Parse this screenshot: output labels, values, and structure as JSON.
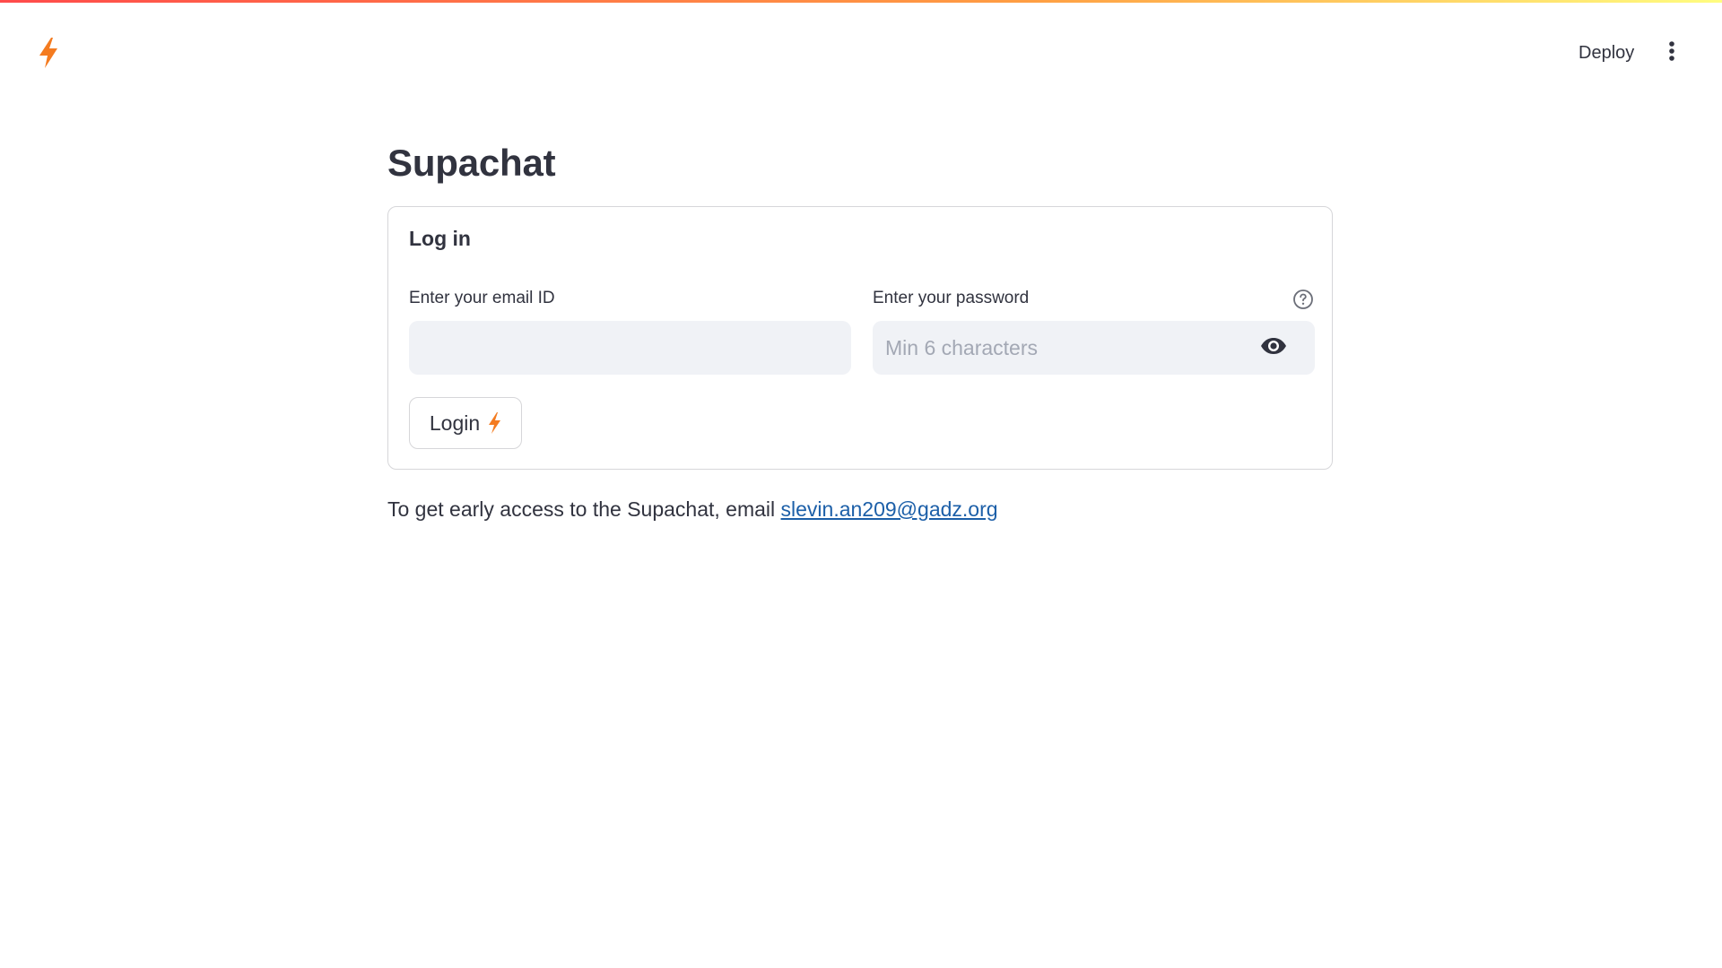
{
  "header": {
    "logo_icon": "lightning-bolt-icon",
    "deploy_label": "Deploy",
    "menu_icon": "vertical-ellipsis-icon"
  },
  "page": {
    "title": "Supachat"
  },
  "login_form": {
    "title": "Log in",
    "email_label": "Enter your email ID",
    "email_value": "",
    "email_placeholder": "",
    "password_label": "Enter your password",
    "password_value": "",
    "password_placeholder": "Min 6 characters",
    "help_icon": "question-circle-icon",
    "show_password_icon": "eye-icon",
    "login_button_label": "Login",
    "login_button_icon": "lightning-bolt-icon"
  },
  "footer": {
    "text": "To get early access to the Supachat, email ",
    "link_text": "slevin.an209@gadz.org"
  },
  "colors": {
    "accent_orange": "#f47b20",
    "link_blue": "#1c5fa8",
    "input_bg": "#f0f2f6",
    "text": "#31333f"
  }
}
